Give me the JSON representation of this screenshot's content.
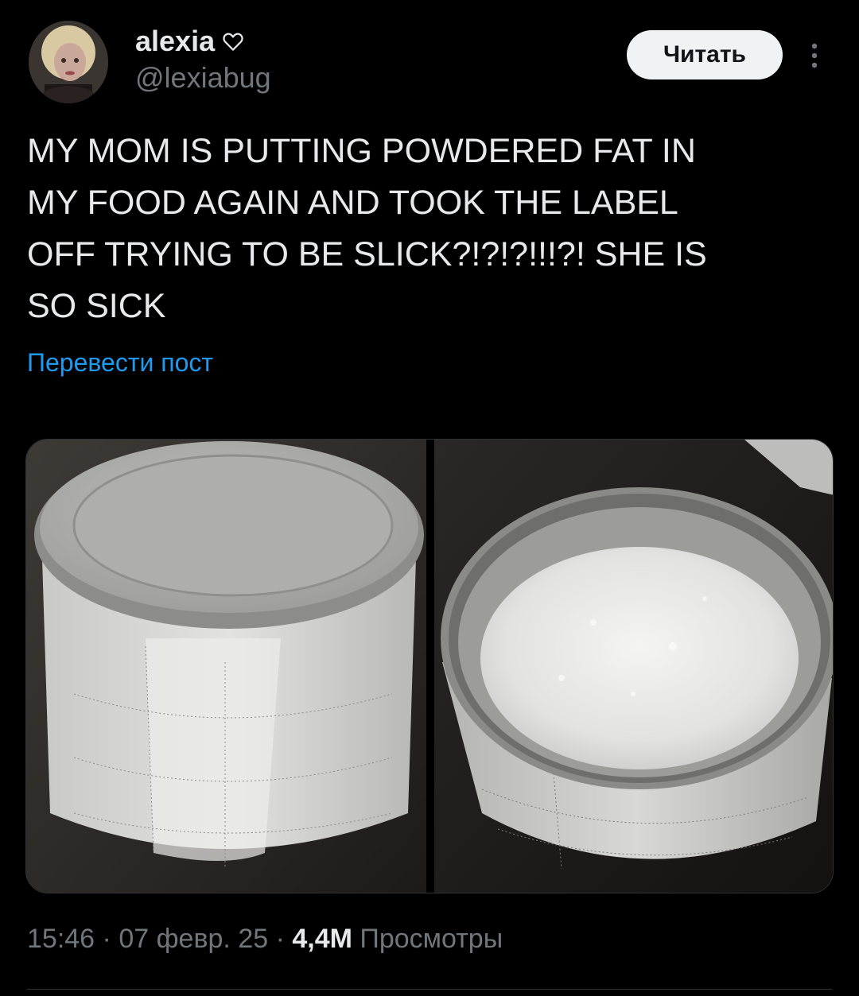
{
  "author": {
    "display_name": "alexia",
    "handle": "@lexiabug",
    "avatar_icon": "avatar-photo",
    "name_badge_icon": "heart-outline-icon"
  },
  "actions": {
    "follow_label": "Читать",
    "more_icon": "more-vertical-icon"
  },
  "tweet": {
    "text": "MY MOM IS PUTTING POWDERED FAT IN\nMY FOOD AGAIN AND TOOK THE LABEL\nOFF TRYING TO BE SLICK?!?!?!!!?! SHE IS\nSO SICK",
    "translate_label": "Перевести пост"
  },
  "media": {
    "count": 2
  },
  "meta": {
    "time": "15:46",
    "date": "07 февр. 25",
    "separator": " · ",
    "views_count": "4,4M",
    "views_label": "Просмотры"
  },
  "colors": {
    "background": "#000000",
    "text": "#e7e9ea",
    "muted": "#71767b",
    "link": "#1d9bf0",
    "button_bg": "#eff3f4",
    "divider": "#2f3336"
  }
}
